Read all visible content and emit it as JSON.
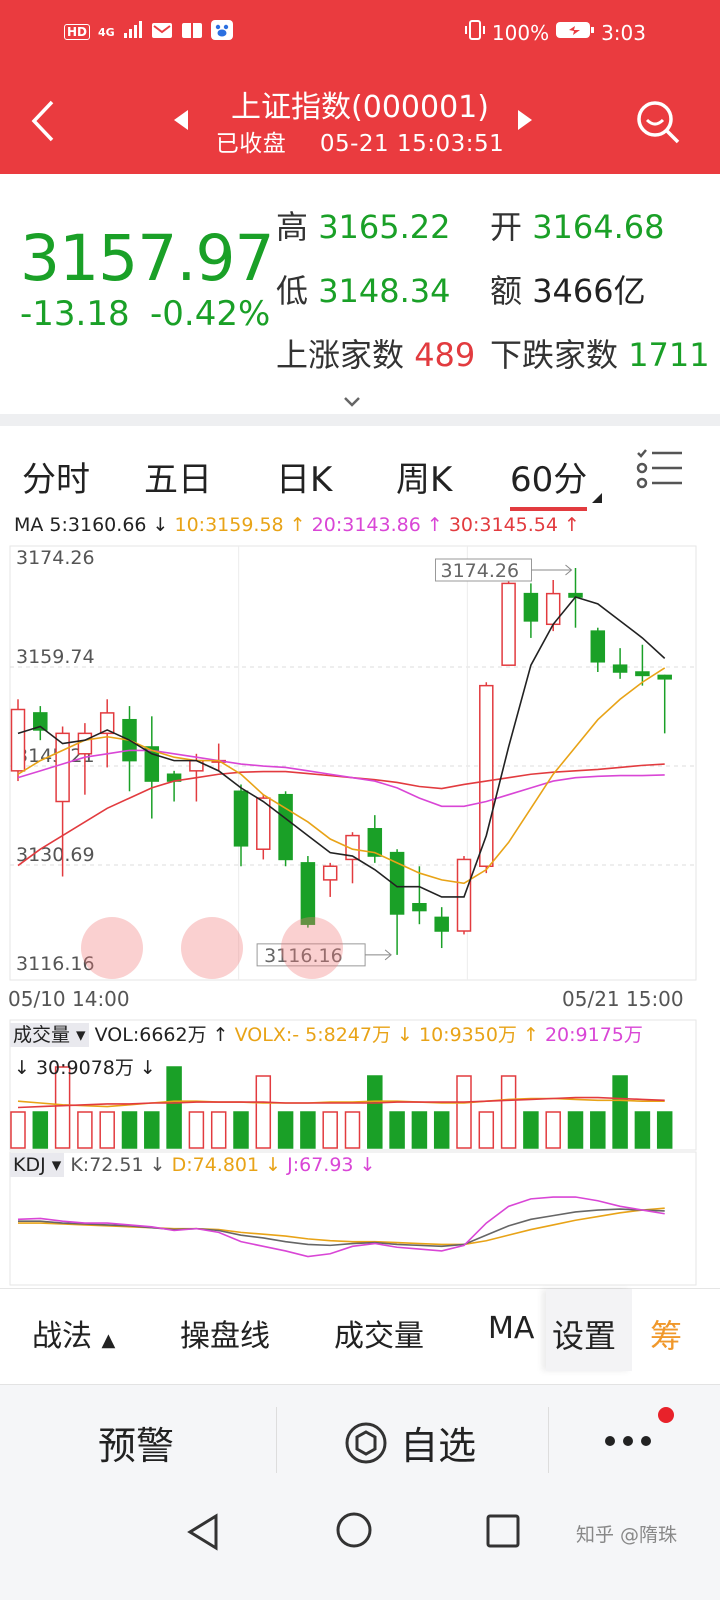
{
  "status_bar": {
    "hd": "HD",
    "net": "4G",
    "battery": "100%",
    "time": "3:03"
  },
  "header": {
    "title": "上证指数(000001)",
    "status": "已收盘",
    "datetime": "05-21 15:03:51"
  },
  "quote": {
    "price": "3157.97",
    "change": "-13.18",
    "change_pct": "-0.42%",
    "high_label": "高",
    "high": "3165.22",
    "open_label": "开",
    "open": "3164.68",
    "low_label": "低",
    "low": "3148.34",
    "amount_label": "额",
    "amount": "3466亿",
    "up_label": "上涨家数",
    "up": "489",
    "down_label": "下跌家数",
    "down": "1711"
  },
  "tabs": [
    {
      "label": "分时"
    },
    {
      "label": "五日"
    },
    {
      "label": "日K"
    },
    {
      "label": "周K"
    },
    {
      "label": "60分"
    }
  ],
  "ma": {
    "ma5": "MA 5:3160.66 ↓",
    "ma10": "10:3159.58 ↑",
    "ma20": "20:3143.86 ↑",
    "ma30": "30:3145.54 ↑",
    "color5": "#222222",
    "color10": "#e8a317",
    "color20": "#d946d6",
    "color30": "#e23b3f"
  },
  "colors": {
    "up": "#e23b3f",
    "down": "#1aa027",
    "header": "#ea3b3f"
  },
  "chart_data": {
    "type": "candlestick",
    "y_ticks": [
      "3174.26",
      "3159.74",
      "3145.21",
      "3130.69",
      "3116.16"
    ],
    "ylim": [
      3116.16,
      3174.26
    ],
    "x_start": "05/10 14:00",
    "x_end": "05/21 15:00",
    "max_marker": "3174.26",
    "min_marker": "3116.16",
    "candles": [
      {
        "o": 3144.5,
        "c": 3153.5,
        "h": 3155.0,
        "l": 3143.0
      },
      {
        "o": 3153.0,
        "c": 3150.5,
        "h": 3154.0,
        "l": 3149.0
      },
      {
        "o": 3140.0,
        "c": 3150.0,
        "h": 3151.0,
        "l": 3129.0
      },
      {
        "o": 3147.0,
        "c": 3150.0,
        "h": 3151.5,
        "l": 3141.0
      },
      {
        "o": 3150.0,
        "c": 3153.0,
        "h": 3155.0,
        "l": 3145.0
      },
      {
        "o": 3152.0,
        "c": 3146.0,
        "h": 3154.0,
        "l": 3141.5
      },
      {
        "o": 3148.0,
        "c": 3143.0,
        "h": 3152.5,
        "l": 3137.5
      },
      {
        "o": 3144.0,
        "c": 3143.0,
        "h": 3144.5,
        "l": 3140.0
      },
      {
        "o": 3144.5,
        "c": 3146.0,
        "h": 3147.0,
        "l": 3140.0
      },
      {
        "o": 3146.0,
        "c": 3146.0,
        "h": 3148.5,
        "l": 3144.5
      },
      {
        "o": 3141.5,
        "c": 3133.5,
        "h": 3142.5,
        "l": 3130.5
      },
      {
        "o": 3133.0,
        "c": 3140.5,
        "h": 3141.0,
        "l": 3131.5
      },
      {
        "o": 3141.0,
        "c": 3131.5,
        "h": 3141.5,
        "l": 3130.5
      },
      {
        "o": 3131.0,
        "c": 3122.0,
        "h": 3132.0,
        "l": 3121.5
      },
      {
        "o": 3128.5,
        "c": 3130.5,
        "h": 3131.0,
        "l": 3126.0
      },
      {
        "o": 3131.5,
        "c": 3135.0,
        "h": 3135.5,
        "l": 3128.0
      },
      {
        "o": 3136.0,
        "c": 3132.0,
        "h": 3138.0,
        "l": 3131.0
      },
      {
        "o": 3132.5,
        "c": 3123.5,
        "h": 3133.0,
        "l": 3117.5
      },
      {
        "o": 3125.0,
        "c": 3124.0,
        "h": 3130.5,
        "l": 3122.0
      },
      {
        "o": 3123.0,
        "c": 3121.0,
        "h": 3124.5,
        "l": 3118.5
      },
      {
        "o": 3121.0,
        "c": 3131.5,
        "h": 3132.0,
        "l": 3120.5
      },
      {
        "o": 3130.5,
        "c": 3157.0,
        "h": 3157.5,
        "l": 3129.5
      },
      {
        "o": 3160.0,
        "c": 3172.0,
        "h": 3173.5,
        "l": 3160.0
      },
      {
        "o": 3170.5,
        "c": 3166.5,
        "h": 3172.0,
        "l": 3164.0
      },
      {
        "o": 3166.0,
        "c": 3170.5,
        "h": 3172.5,
        "l": 3165.0
      },
      {
        "o": 3170.5,
        "c": 3170.0,
        "h": 3174.26,
        "l": 3165.5
      },
      {
        "o": 3165.0,
        "c": 3160.5,
        "h": 3165.5,
        "l": 3159.0
      },
      {
        "o": 3160.0,
        "c": 3159.0,
        "h": 3162.5,
        "l": 3158.0
      },
      {
        "o": 3159.0,
        "c": 3158.5,
        "h": 3163.0,
        "l": 3157.0
      },
      {
        "o": 3158.5,
        "c": 3158.0,
        "h": 3158.6,
        "l": 3150.0
      }
    ],
    "ma5_line": [
      3150,
      3151,
      3148.5,
      3149,
      3150.5,
      3149,
      3147,
      3146,
      3146,
      3144.5,
      3142,
      3140,
      3137.5,
      3135,
      3132.5,
      3132,
      3130,
      3127.5,
      3127.5,
      3126,
      3126,
      3135,
      3148,
      3160,
      3166,
      3170,
      3169,
      3166.5,
      3164,
      3161
    ],
    "ma10_line": [
      3144,
      3146,
      3147.5,
      3149,
      3149.5,
      3149,
      3147.5,
      3146.5,
      3146,
      3146,
      3144,
      3141,
      3139,
      3137,
      3134.5,
      3133,
      3132.5,
      3131,
      3129.5,
      3128.5,
      3128,
      3130,
      3134,
      3139,
      3144,
      3148,
      3152,
      3155,
      3157.5,
      3159.6
    ],
    "ma20_line": [
      3143.5,
      3144.5,
      3145.5,
      3146.5,
      3147,
      3147.5,
      3147.5,
      3147,
      3146.5,
      3146,
      3145.5,
      3145.2,
      3145,
      3144.5,
      3144,
      3143.5,
      3143,
      3142,
      3140.5,
      3139.3,
      3139.3,
      3140,
      3141,
      3142,
      3143,
      3143.5,
      3143.7,
      3143.8,
      3143.8,
      3143.9
    ],
    "ma30_line": [
      3130.6,
      3133,
      3135,
      3137,
      3139,
      3140.5,
      3142,
      3143,
      3143.5,
      3144,
      3144.3,
      3144.4,
      3144.4,
      3144.1,
      3143.8,
      3143.5,
      3143.2,
      3142.8,
      3142.2,
      3141.9,
      3142.5,
      3143,
      3143.5,
      3144,
      3144.3,
      3144.5,
      3144.7,
      3145,
      3145.3,
      3145.5
    ],
    "volume": {
      "label": "成交量",
      "vol": "VOL:6662万 ↑",
      "volx": "VOLX:- 5:8247万 ↓",
      "v10": "10:9350万 ↑",
      "v20": "20:9175万",
      "v30": "↓ 30:9078万 ↓",
      "bars": [
        4,
        4,
        9,
        4,
        4,
        4,
        4,
        9,
        4,
        4,
        4,
        8,
        4,
        4,
        4,
        4,
        8,
        4,
        4,
        4,
        8,
        4,
        8,
        4,
        4,
        4,
        4,
        8,
        4,
        4
      ],
      "line_a": [
        0.52,
        0.5,
        0.48,
        0.47,
        0.46,
        0.48,
        0.5,
        0.52,
        0.52,
        0.51,
        0.51,
        0.5,
        0.5,
        0.5,
        0.51,
        0.51,
        0.52,
        0.52,
        0.51,
        0.5,
        0.5,
        0.52,
        0.54,
        0.55,
        0.55,
        0.54,
        0.53,
        0.53,
        0.52,
        0.52
      ],
      "line_b": [
        0.45,
        0.46,
        0.47,
        0.48,
        0.49,
        0.49,
        0.5,
        0.5,
        0.51,
        0.51,
        0.51,
        0.51,
        0.5,
        0.5,
        0.5,
        0.5,
        0.5,
        0.51,
        0.51,
        0.51,
        0.51,
        0.52,
        0.53,
        0.54,
        0.55,
        0.56,
        0.56,
        0.55,
        0.54,
        0.53
      ]
    },
    "kdj": {
      "label": "KDJ",
      "k": "K:72.51 ↓",
      "d": "D:74.801 ↓",
      "j": "J:67.93 ↓",
      "k_line": [
        60,
        60,
        58,
        57,
        56,
        55,
        53,
        51,
        52,
        50,
        45,
        42,
        38,
        35,
        34,
        36,
        37,
        35,
        34,
        33,
        35,
        45,
        55,
        62,
        66,
        70,
        72,
        73,
        72,
        71
      ],
      "d_line": [
        58,
        58,
        57,
        56,
        55,
        54,
        53,
        52,
        52,
        51,
        48,
        46,
        44,
        41,
        39,
        38,
        38,
        37,
        36,
        35,
        35,
        39,
        45,
        51,
        56,
        61,
        65,
        69,
        72,
        74
      ],
      "j_line": [
        62,
        63,
        60,
        58,
        58,
        56,
        54,
        50,
        52,
        48,
        38,
        33,
        28,
        22,
        25,
        33,
        36,
        32,
        30,
        28,
        34,
        58,
        76,
        84,
        86,
        86,
        82,
        76,
        72,
        68
      ]
    }
  },
  "toolbar": {
    "items": [
      "战法",
      "操盘线",
      "成交量",
      "MA"
    ],
    "settings": "设置",
    "chip": "筹"
  },
  "actions": {
    "alert": "预警",
    "watch": "自选"
  },
  "watermark": "知乎 @隋珠"
}
